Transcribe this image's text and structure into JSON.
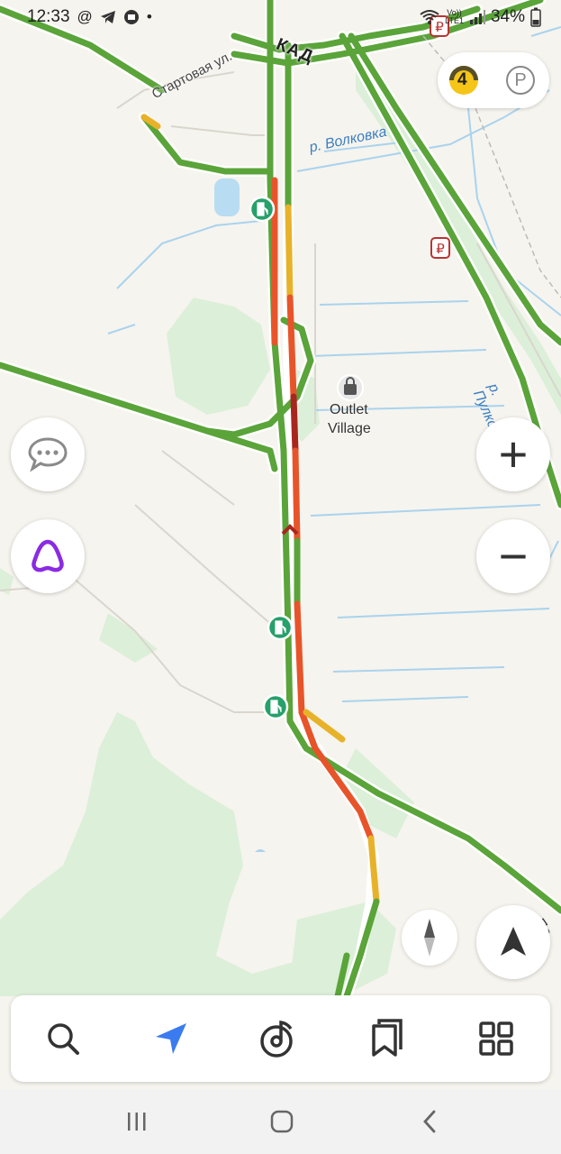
{
  "status_bar": {
    "time": "12:33",
    "left_icons": [
      "at-sign-icon",
      "telegram-icon",
      "delivery-icon",
      "dot-icon"
    ],
    "lte_label": "LTE1",
    "volte_label": "Vo))",
    "battery": "34%"
  },
  "map": {
    "road_labels": {
      "kad": "КАД",
      "startovaya": "Стартовая ул.",
      "pulkovka": "р. Пулковка"
    },
    "water_labels": {
      "volkovka": "р. Волковка"
    },
    "poi": {
      "outlet_line1": "Outlet",
      "outlet_line2": "Village"
    },
    "edge_label": "Пе"
  },
  "traffic_widget": {
    "level": "4",
    "parking_label": "P",
    "traffic_color": "#f5c518"
  },
  "controls": {
    "zoom_in": "+",
    "zoom_out": "−"
  },
  "bottom_tabs": [
    "search",
    "navigator",
    "music",
    "bookmarks",
    "services"
  ],
  "colors": {
    "accent": "#3a7bf0",
    "alice": "#8a2be2",
    "green": "#5aa43a",
    "jam_red": "#e8542a",
    "jam_dark": "#a7271e",
    "jam_yellow": "#e7b22a"
  }
}
